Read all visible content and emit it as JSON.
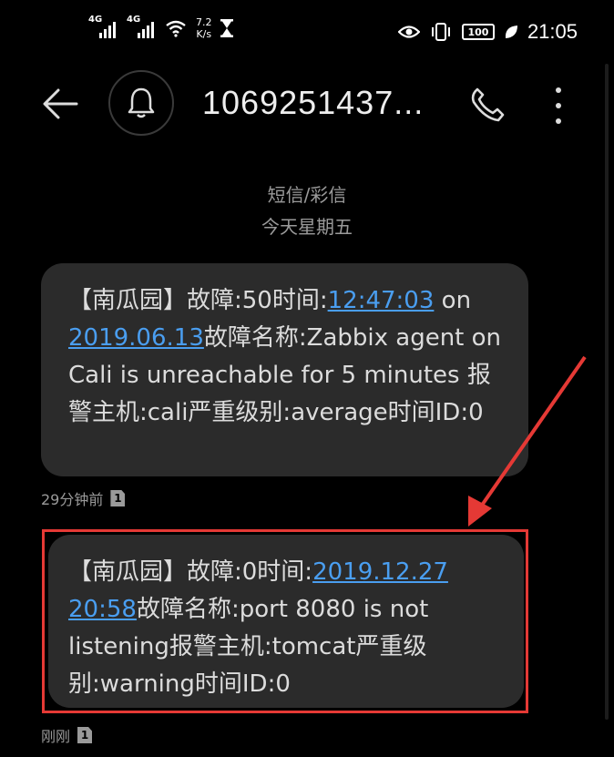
{
  "status_bar": {
    "sim1": "4G",
    "sim2": "4G",
    "speed_value": "7.2",
    "speed_unit": "K/s",
    "battery": "100",
    "time": "21:05"
  },
  "app_bar": {
    "title": "1069251437..."
  },
  "thread": {
    "channel": "短信/彩信",
    "day": "今天星期五"
  },
  "messages": [
    {
      "part1": "【南瓜园】故障:50时间:",
      "link1": "12:47:03",
      "part2": " on ",
      "link2": "2019.06.13",
      "part3": "故障名称:Zabbix agent on Cali is unreachable for 5 minutes 报警主机:cali严重级别:average时间ID:0",
      "timestamp": "29分钟前",
      "sim": "1"
    },
    {
      "part1": "【南瓜园】故障:0时间:",
      "link1": "2019.12.27 20:58",
      "part2": "故障名称:port 8080 is not listening报警主机:tomcat严重级别:warning时间ID:0",
      "timestamp": "刚刚",
      "sim": "1"
    }
  ],
  "colors": {
    "background": "#000000",
    "bubble": "#2b2b2b",
    "link": "#4a9ef0",
    "annotation": "#e53935"
  }
}
